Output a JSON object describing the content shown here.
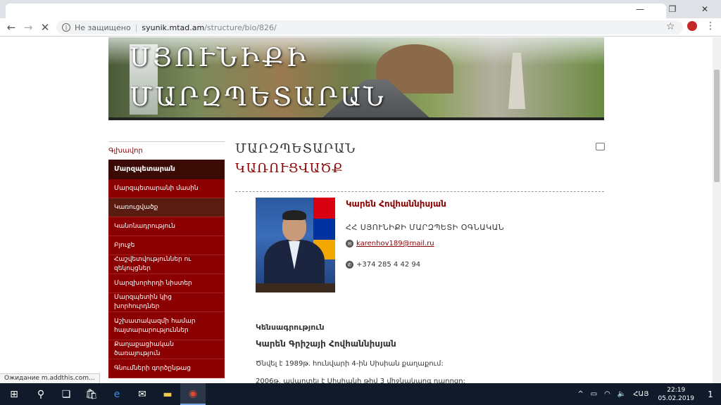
{
  "browser": {
    "address": {
      "security_label": "Не защищено",
      "host": "syunik.mtad.am",
      "path": "/structure/bio/826/"
    },
    "status_text": "Ожидание m.addthis.com..."
  },
  "banner": {
    "title_line1": "ՍՅՈՒՆԻՔԻ",
    "title_line2": "ՄԱՐԶՊԵՏԱՐԱՆ"
  },
  "sidebar": {
    "home": "Գլխավոր",
    "header": "Մարզպետարան",
    "items": [
      {
        "label": "Մարզպետարանի մասին"
      },
      {
        "label": "Կառուցվածք"
      },
      {
        "label": "Կանոնադրություն"
      },
      {
        "label": "Բյուջե"
      },
      {
        "label": "Հաշվետվություններ ու զեկույցներ"
      },
      {
        "label": "Մարզխորհրդի նիստեր"
      },
      {
        "label": "Մարզպետին կից խորհուրդներ"
      },
      {
        "label": "Աշխատակազմի համար հայտարարություններ"
      },
      {
        "label": "Քաղաքացիական ծառայություն"
      },
      {
        "label": "Գնումների գործընթաց"
      }
    ]
  },
  "content": {
    "title_line1": "ՄԱՐԶՊԵՏԱՐԱՆ",
    "title_line2": "ԿԱՌՈՒՑՎԱԾՔ",
    "person": {
      "name": "Կարեն Հովհաննիսյան",
      "position": "ՀՀ ՍՅՈՒՆԻՔԻ ՄԱՐԶՊԵՏԻ ՕԳՆԱԿԱՆ",
      "email": "karenhov189@mail.ru",
      "phone": "+374 285 4 42 94"
    },
    "bio": {
      "heading": "Կենսագրություն",
      "full_name": "Կարեն Գրիշայի Հովհաննիսյան",
      "p1": "Ծնվել է 1989թ. հունվարի 4-ին  Սիսիան քաղաքում:",
      "p2": "2006թ. ավարտել է Սիսիանի թիվ 3 միջնակարգ դպրոցը:"
    }
  },
  "taskbar": {
    "lang": "ՀԱՅ",
    "time": "22:19",
    "date": "05.02.2019",
    "notifications": "1"
  }
}
